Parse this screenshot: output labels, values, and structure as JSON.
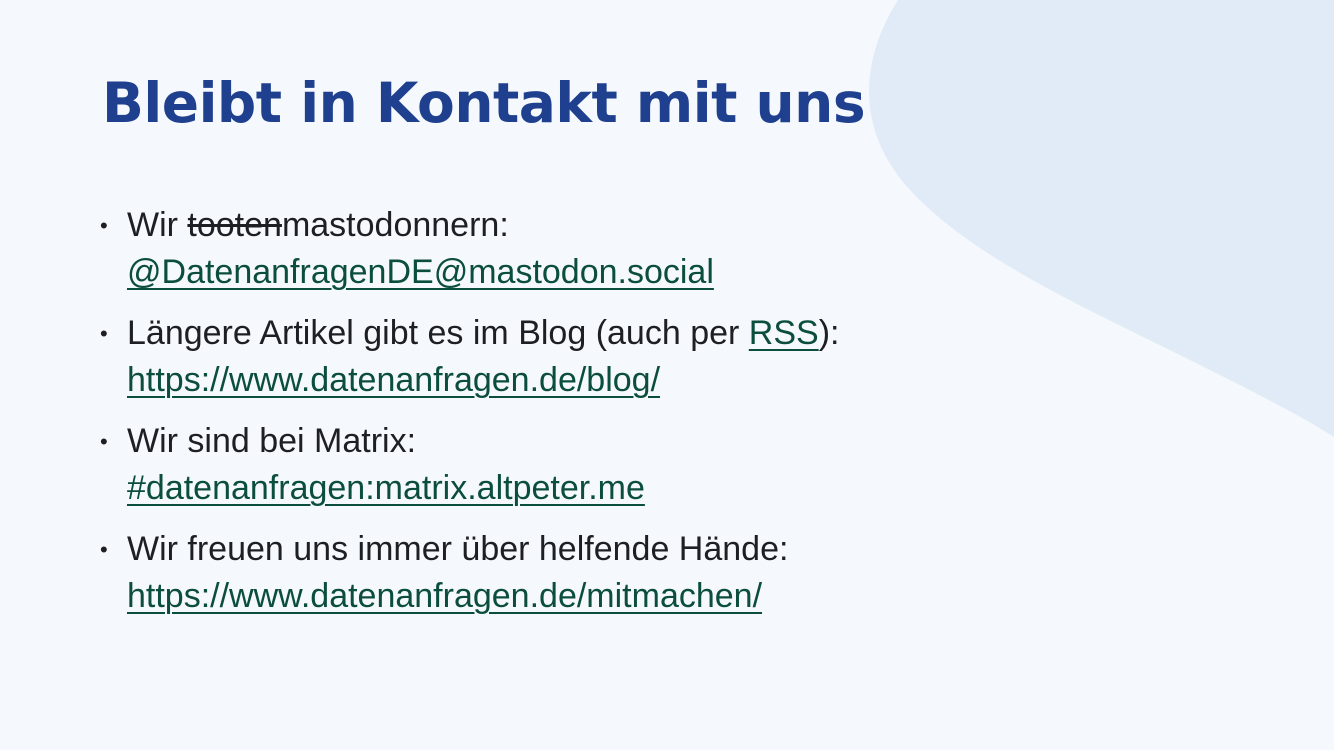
{
  "slide": {
    "title": "Bleibt in Kontakt mit uns",
    "colors": {
      "background": "#f5f8fc",
      "shape": "#e0ebf7",
      "title": "#1f3f8f",
      "text": "#1d1f24",
      "link": "#0c4e3e"
    },
    "bullet_char": "•",
    "items": [
      {
        "prefix": "Wir ",
        "struck": "tooten",
        "text": "mastodonnern:",
        "link": "@DatenanfragenDE@mastodon.social"
      },
      {
        "text": "Längere Artikel gibt es im Blog (auch per ",
        "inline_link": "RSS",
        "suffix": "):",
        "link": "https://www.datenanfragen.de/blog/"
      },
      {
        "text": "Wir sind bei Matrix:",
        "link": "#datenanfragen:matrix.altpeter.me"
      },
      {
        "text": "Wir freuen uns immer über helfende Hände:",
        "link": "https://www.datenanfragen.de/mitmachen/"
      }
    ]
  }
}
